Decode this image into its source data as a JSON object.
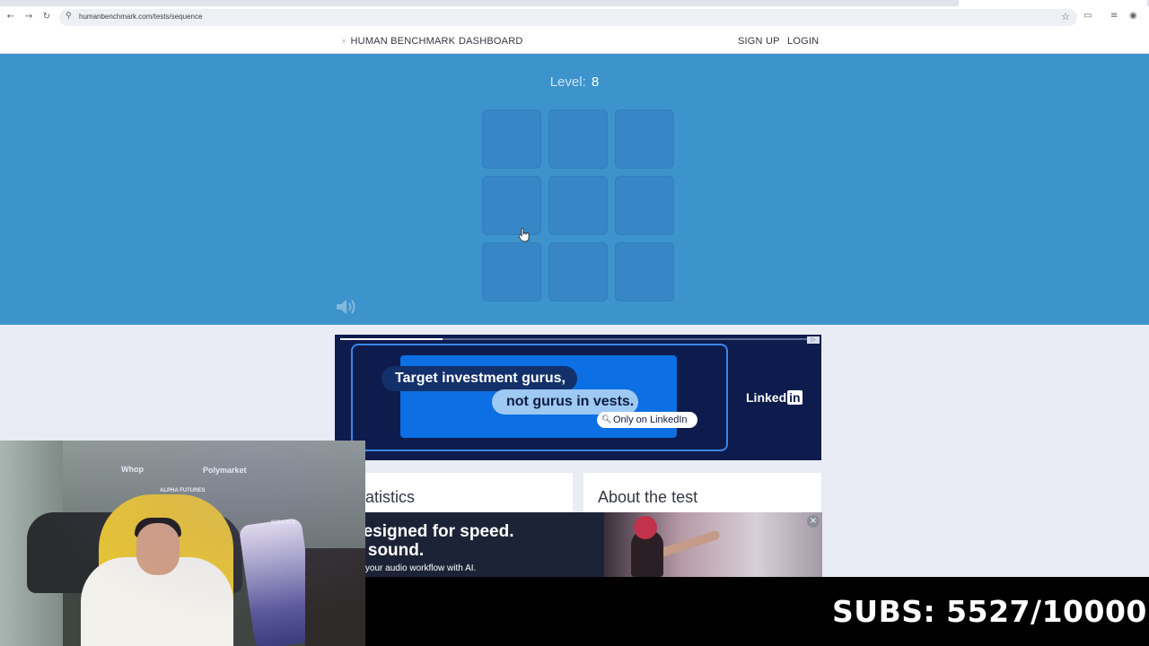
{
  "browser": {
    "url": "humanbenchmark.com/tests/sequence",
    "back_icon": "←",
    "forward_icon": "→",
    "reload_icon": "↻",
    "site_info_icon": "⚲",
    "bookmark_icon": "☆"
  },
  "nav": {
    "brand": "HUMAN BENCHMARK",
    "dashboard": "DASHBOARD",
    "signup": "SIGN UP",
    "login": "LOGIN"
  },
  "game": {
    "level_label": "Level:",
    "level_value": "8",
    "tile_color": "#3786c6",
    "background_color": "#3d94cc",
    "tiles": [
      "",
      "",
      "",
      "",
      "",
      "",
      "",
      "",
      ""
    ]
  },
  "ad_linkedin": {
    "line1": "Target investment gurus,",
    "line2": "not gurus in vests.",
    "tag": "Only on LinkedIn",
    "brand_word": "Linked",
    "brand_in": "in",
    "progress": 0.22
  },
  "cards": {
    "statistics_title": "atistics",
    "about_title": "About the test"
  },
  "ad_audio": {
    "headline1": "designed for speed.",
    "headline2": "d sound.",
    "subline": "up your audio workflow with AI.",
    "close_icon": "×"
  },
  "stream": {
    "subs_text": "SUBS: 5527/10000",
    "logos": [
      "Whop",
      "ALPHA FUTURES",
      "Polymarket",
      "SHUFFLE"
    ]
  }
}
